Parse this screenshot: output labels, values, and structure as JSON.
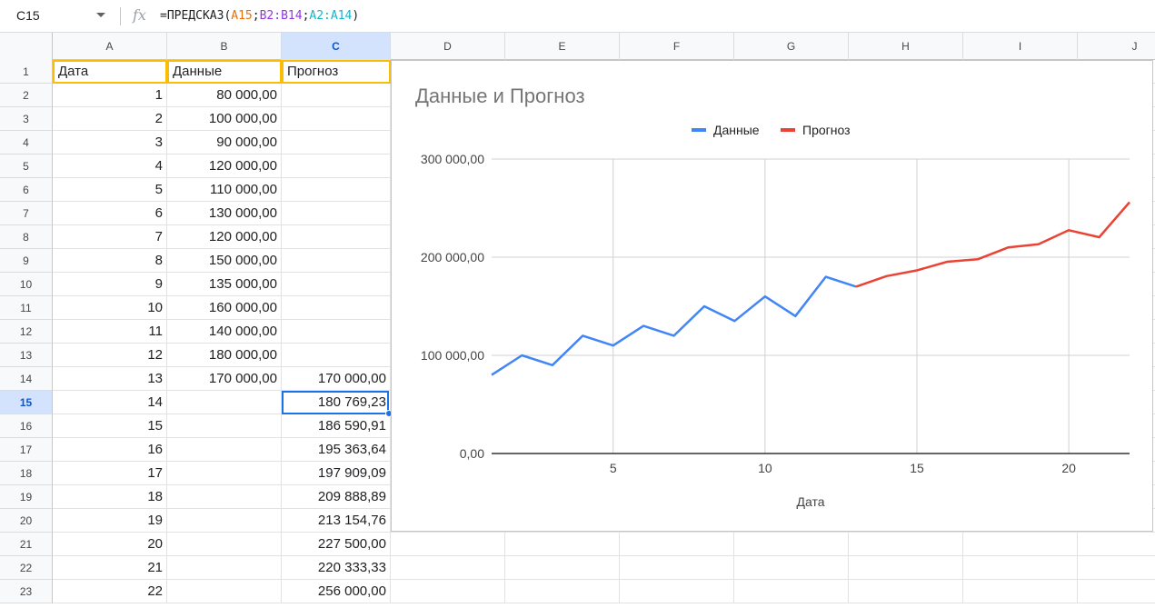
{
  "formula_bar": {
    "cell_ref": "C15",
    "fx_label": "fx",
    "formula_prefix": "=ПРЕДСКАЗ(",
    "formula_ref1": "A15",
    "formula_sep1": ";",
    "formula_ref2": "B2:B14",
    "formula_sep2": ";",
    "formula_ref3": "A2:A14",
    "formula_suffix": ")"
  },
  "columns": [
    "A",
    "B",
    "C",
    "D",
    "E",
    "F",
    "G",
    "H",
    "I",
    "J"
  ],
  "selected_column": "C",
  "selected_row": 15,
  "headers": {
    "a": "Дата",
    "b": "Данные",
    "c": "Прогноз"
  },
  "rows": [
    {
      "n": "2",
      "a": "1",
      "b": "80 000,00",
      "c": ""
    },
    {
      "n": "3",
      "a": "2",
      "b": "100 000,00",
      "c": ""
    },
    {
      "n": "4",
      "a": "3",
      "b": "90 000,00",
      "c": ""
    },
    {
      "n": "5",
      "a": "4",
      "b": "120 000,00",
      "c": ""
    },
    {
      "n": "6",
      "a": "5",
      "b": "110 000,00",
      "c": ""
    },
    {
      "n": "7",
      "a": "6",
      "b": "130 000,00",
      "c": ""
    },
    {
      "n": "8",
      "a": "7",
      "b": "120 000,00",
      "c": ""
    },
    {
      "n": "9",
      "a": "8",
      "b": "150 000,00",
      "c": ""
    },
    {
      "n": "10",
      "a": "9",
      "b": "135 000,00",
      "c": ""
    },
    {
      "n": "11",
      "a": "10",
      "b": "160 000,00",
      "c": ""
    },
    {
      "n": "12",
      "a": "11",
      "b": "140 000,00",
      "c": ""
    },
    {
      "n": "13",
      "a": "12",
      "b": "180 000,00",
      "c": ""
    },
    {
      "n": "14",
      "a": "13",
      "b": "170 000,00",
      "c": "170 000,00"
    },
    {
      "n": "15",
      "a": "14",
      "b": "",
      "c": "180 769,23"
    },
    {
      "n": "16",
      "a": "15",
      "b": "",
      "c": "186 590,91"
    },
    {
      "n": "17",
      "a": "16",
      "b": "",
      "c": "195 363,64"
    },
    {
      "n": "18",
      "a": "17",
      "b": "",
      "c": "197 909,09"
    },
    {
      "n": "19",
      "a": "18",
      "b": "",
      "c": "209 888,89"
    },
    {
      "n": "20",
      "a": "19",
      "b": "",
      "c": "213 154,76"
    },
    {
      "n": "21",
      "a": "20",
      "b": "",
      "c": "227 500,00"
    },
    {
      "n": "22",
      "a": "21",
      "b": "",
      "c": "220 333,33"
    },
    {
      "n": "23",
      "a": "22",
      "b": "",
      "c": "256 000,00"
    }
  ],
  "chart_data": {
    "type": "line",
    "title": "Данные и Прогноз",
    "xlabel": "Дата",
    "ylabel": "",
    "xlim": [
      1,
      22
    ],
    "ylim": [
      0,
      300000
    ],
    "x_ticks": [
      "5",
      "10",
      "15",
      "20"
    ],
    "x_tick_values": [
      5,
      10,
      15,
      20
    ],
    "y_ticks": [
      "0,00",
      "100 000,00",
      "200 000,00",
      "300 000,00"
    ],
    "y_tick_values": [
      0,
      100000,
      200000,
      300000
    ],
    "grid": true,
    "legend_position": "top",
    "series": [
      {
        "name": "Данные",
        "color": "#4285f4",
        "x": [
          1,
          2,
          3,
          4,
          5,
          6,
          7,
          8,
          9,
          10,
          11,
          12,
          13
        ],
        "values": [
          80000,
          100000,
          90000,
          120000,
          110000,
          130000,
          120000,
          150000,
          135000,
          160000,
          140000,
          180000,
          170000
        ]
      },
      {
        "name": "Прогноз",
        "color": "#ea4335",
        "x": [
          13,
          14,
          15,
          16,
          17,
          18,
          19,
          20,
          21,
          22
        ],
        "values": [
          170000,
          180769.23,
          186590.91,
          195363.64,
          197909.09,
          209888.89,
          213154.76,
          227500,
          220333.33,
          256000
        ]
      }
    ]
  }
}
